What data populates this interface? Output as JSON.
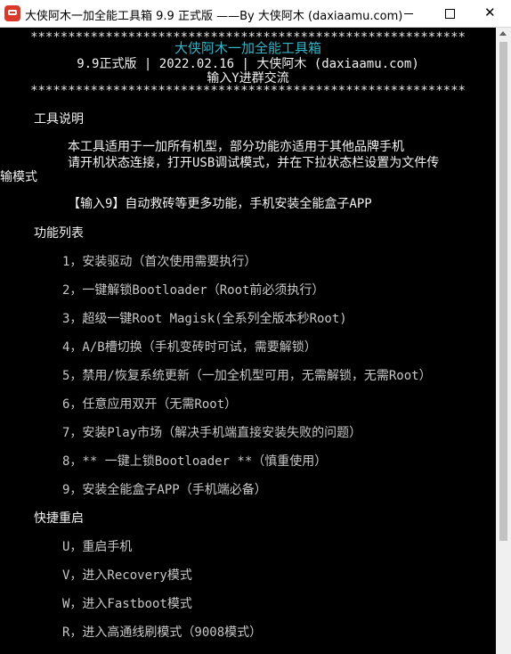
{
  "window": {
    "title": "大侠阿木一加全能工具箱 9.9 正式版 ——By 大侠阿木 (daxiaamu.com)"
  },
  "header": {
    "stars_top": "**********************************************************",
    "app_name": "大侠阿木一加全能工具箱",
    "version_line": "9.9正式版 | 2022.02.16 | 大侠阿木 (daxiaamu.com)",
    "group_hint": "输入Y进群交流",
    "stars_bottom": "**********************************************************"
  },
  "intro": {
    "heading": "工具说明",
    "line1": "本工具适用于一加所有机型，部分功能亦适用于其他品牌手机",
    "line2": "请开机状态连接，打开USB调试模式，并在下拉状态栏设置为文件传",
    "line3": "输模式",
    "tip": "【输入9】自动救砖等更多功能，手机安装全能盒子APP"
  },
  "functions": {
    "heading": "功能列表",
    "items": [
      "1，安装驱动（首次使用需要执行）",
      "2，一键解锁Bootloader（Root前必须执行）",
      "3，超级一键Root Magisk(全系列全版本秒Root)",
      "4，A/B槽切换（手机变砖时可试，需要解锁）",
      "5，禁用/恢复系统更新（一加全机型可用，无需解锁，无需Root）",
      "6，任意应用双开（无需Root）",
      "7，安装Play市场（解决手机端直接安装失败的问题）",
      "8，** 一键上锁Bootloader **（慎重使用）",
      "9，安装全能盒子APP（手机端必备）"
    ]
  },
  "reboot": {
    "heading": "快捷重启",
    "items": [
      "U，重启手机",
      "V，进入Recovery模式",
      "W，进入Fastboot模式",
      "R，进入高通线刷模式（9008模式）"
    ]
  },
  "colors": {
    "background": "#000000",
    "accent_cyan": "#33b6c8",
    "text_white": "#f2f2f2"
  }
}
